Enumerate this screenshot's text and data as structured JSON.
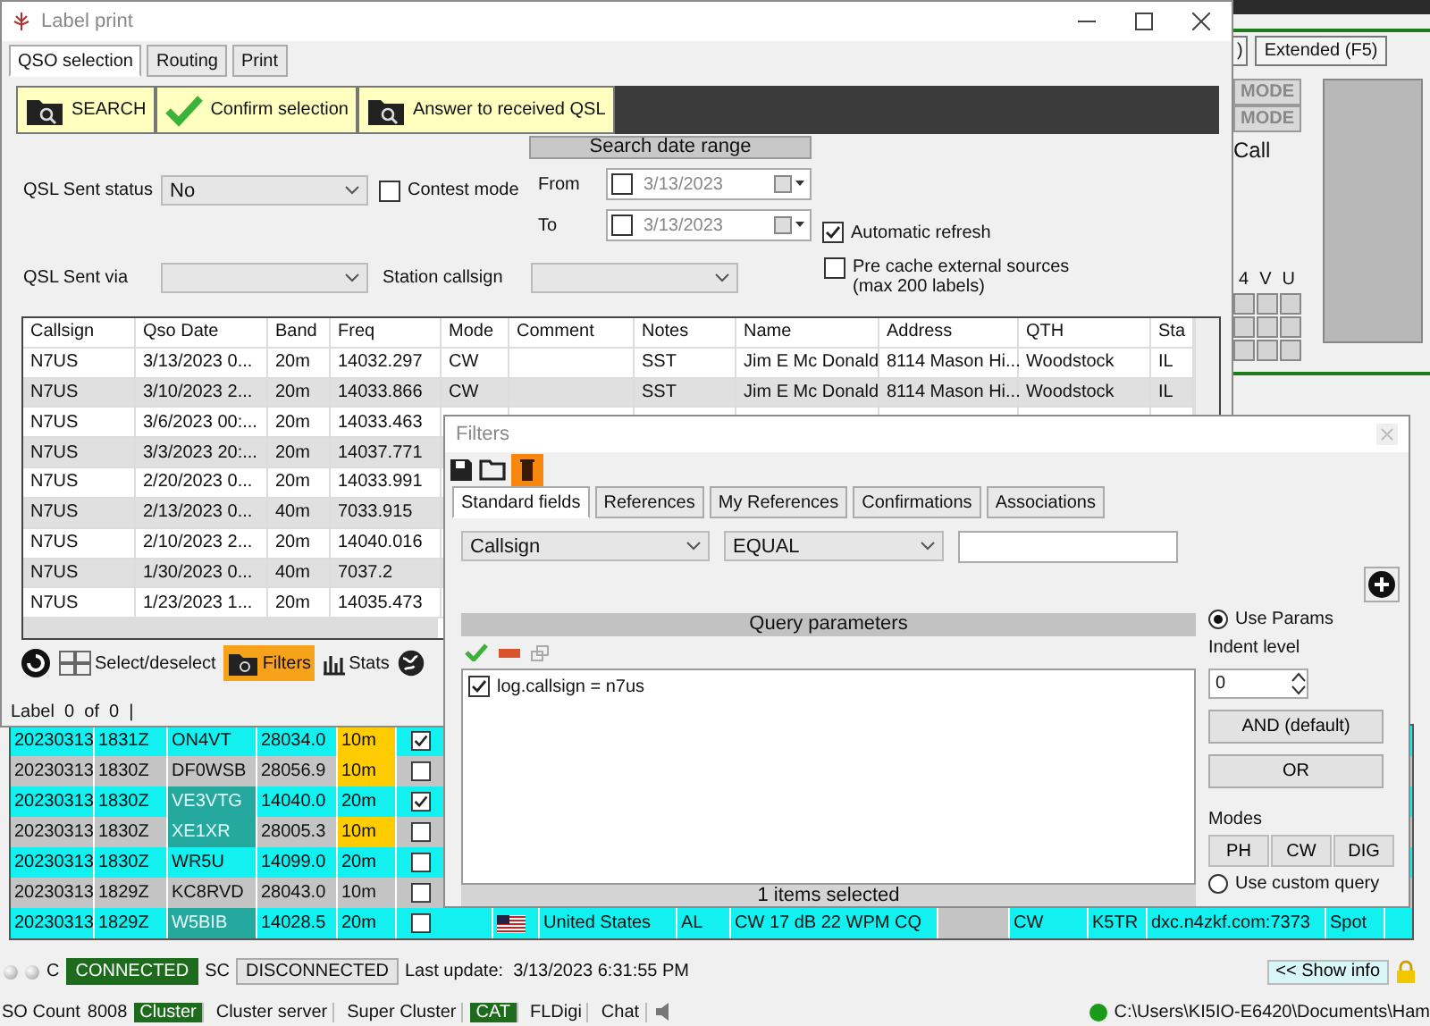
{
  "label_print": {
    "title": "Label print",
    "tabs": [
      {
        "label": "QSO selection",
        "selected": true
      },
      {
        "label": "Routing",
        "selected": false
      },
      {
        "label": "Print",
        "selected": false
      }
    ],
    "actions": [
      {
        "label": "SEARCH",
        "kind": "folder"
      },
      {
        "label": "Confirm selection",
        "kind": "check"
      },
      {
        "label": "Answer to received QSL",
        "kind": "folder"
      }
    ],
    "qsl_sent_status": {
      "label": "QSL Sent status",
      "value": "No"
    },
    "contest_mode": {
      "label": "Contest mode",
      "checked": false
    },
    "date_range": {
      "title": "Search date range",
      "fields": [
        {
          "label": "From",
          "value": "3/13/2023",
          "checked": false
        },
        {
          "label": "To",
          "value": "3/13/2023",
          "checked": false
        }
      ]
    },
    "automatic_refresh": {
      "label": "Automatic refresh",
      "checked": true
    },
    "qsl_sent_via": {
      "label": "QSL Sent via"
    },
    "station_callsign": {
      "label": "Station callsign"
    },
    "pre_cache": {
      "label": "Pre cache external sources\n(max 200 labels)",
      "checked": false
    },
    "table": {
      "columns": [
        "Callsign",
        "Qso Date",
        "Band",
        "Freq",
        "Mode",
        "Comment",
        "Notes",
        "Name",
        "Address",
        "QTH",
        "Sta"
      ],
      "rows": [
        {
          "callsign": "N7US",
          "qso_date": "3/13/2023 0...",
          "band": "20m",
          "freq": "14032.297",
          "mode": "CW",
          "notes": "SST",
          "name": "Jim E Mc Donald",
          "address": "8114 Mason Hi...",
          "qth": "Woodstock",
          "state": "IL"
        },
        {
          "callsign": "N7US",
          "qso_date": "3/10/2023 2...",
          "band": "20m",
          "freq": "14033.866",
          "mode": "CW",
          "notes": "SST",
          "name": "Jim E Mc Donald",
          "address": "8114 Mason Hi...",
          "qth": "Woodstock",
          "state": "IL"
        },
        {
          "callsign": "N7US",
          "qso_date": "3/6/2023 00:...",
          "band": "20m",
          "freq": "14033.463"
        },
        {
          "callsign": "N7US",
          "qso_date": "3/3/2023 20:...",
          "band": "20m",
          "freq": "14037.771"
        },
        {
          "callsign": "N7US",
          "qso_date": "2/20/2023 0...",
          "band": "20m",
          "freq": "14033.991"
        },
        {
          "callsign": "N7US",
          "qso_date": "2/13/2023 0...",
          "band": "40m",
          "freq": "7033.915"
        },
        {
          "callsign": "N7US",
          "qso_date": "2/10/2023 2...",
          "band": "20m",
          "freq": "14040.016"
        },
        {
          "callsign": "N7US",
          "qso_date": "1/30/2023 0...",
          "band": "40m",
          "freq": "7037.2"
        },
        {
          "callsign": "N7US",
          "qso_date": "1/23/2023 1...",
          "band": "20m",
          "freq": "14035.473"
        }
      ]
    },
    "tools": [
      {
        "kind": "refresh"
      },
      {
        "kind": "grid",
        "label": "Select/deselect",
        "selected": false
      },
      {
        "kind": "filter",
        "label": "Filters",
        "selected": true
      },
      {
        "kind": "stats",
        "label": "Stats",
        "selected": false
      },
      {
        "kind": "globe"
      }
    ],
    "counter": "Label  0  of  0  |"
  },
  "filters": {
    "title": "Filters",
    "tools": [
      {
        "kind": "save"
      },
      {
        "kind": "open"
      },
      {
        "kind": "delete"
      }
    ],
    "tabs": [
      {
        "label": "Standard fields",
        "selected": true
      },
      {
        "label": "References",
        "selected": false
      },
      {
        "label": "My References",
        "selected": false
      },
      {
        "label": "Confirmations",
        "selected": false
      },
      {
        "label": "Associations",
        "selected": false
      }
    ],
    "field": "Callsign",
    "operator": "EQUAL",
    "query": {
      "title": "Query parameters",
      "items": [
        {
          "text": "log.callsign = n7us",
          "checked": true
        }
      ],
      "footer": "1 items selected"
    },
    "use_params": {
      "label": "Use Params",
      "selected": true
    },
    "indent": {
      "label": "Indent level",
      "value": "0"
    },
    "logic_buttons": [
      "AND (default)",
      "OR"
    ],
    "modes": {
      "label": "Modes",
      "buttons": [
        "PH",
        "CW",
        "DIG"
      ]
    },
    "custom_query": {
      "label": "Use custom query",
      "selected": false
    }
  },
  "main": {
    "partial_button": ")",
    "extended_button": "Extended (F5)",
    "mode_buttons": [
      "MODE",
      "MODE"
    ],
    "call_label": "Call",
    "band_labels": [
      "4",
      "V",
      "U"
    ],
    "spots": [
      {
        "date": "20230313",
        "time": "1831Z",
        "call": "ON4VT",
        "freq": "28034.0",
        "band": "10m",
        "call_highlight": false,
        "band_highlight": true,
        "checked": true
      },
      {
        "date": "20230313",
        "time": "1830Z",
        "call": "DF0WSB",
        "freq": "28056.9",
        "band": "10m",
        "call_highlight": false,
        "band_highlight": true,
        "checked": false
      },
      {
        "date": "20230313",
        "time": "1830Z",
        "call": "VE3VTG",
        "freq": "14040.0",
        "band": "20m",
        "call_highlight": true,
        "band_highlight": false,
        "checked": true
      },
      {
        "date": "20230313",
        "time": "1830Z",
        "call": "XE1XR",
        "freq": "28005.3",
        "band": "10m",
        "call_highlight": true,
        "band_highlight": true,
        "checked": false
      },
      {
        "date": "20230313",
        "time": "1830Z",
        "call": "WR5U",
        "freq": "14099.0",
        "band": "20m",
        "call_highlight": false,
        "band_highlight": false,
        "checked": false
      },
      {
        "date": "20230313",
        "time": "1829Z",
        "call": "KC8RVD",
        "freq": "28043.0",
        "band": "10m",
        "call_highlight": false,
        "band_highlight": false,
        "checked": false
      },
      {
        "date": "20230313",
        "time": "1829Z",
        "call": "W5BIB",
        "freq": "14028.5",
        "band": "20m",
        "call_highlight": true,
        "band_highlight": false,
        "checked": false,
        "details": [
          {
            "kind": "flag"
          },
          {
            "kind": "text",
            "text": "United States"
          },
          {
            "kind": "text",
            "text": "AL"
          },
          {
            "kind": "text",
            "text": "CW 17 dB 22 WPM CQ"
          },
          {
            "kind": "empty"
          },
          {
            "kind": "text",
            "text": "CW"
          },
          {
            "kind": "text",
            "text": "K5TR"
          },
          {
            "kind": "text",
            "text": "dxc.n4zkf.com:7373"
          },
          {
            "kind": "text",
            "text": "Spot"
          }
        ]
      }
    ],
    "connections": [
      {
        "label": "C",
        "state": "CONNECTED",
        "connected": true
      },
      {
        "label": "SC",
        "state": "DISCONNECTED",
        "connected": false
      }
    ],
    "last_update": "Last update:  3/13/2023 6:31:55 PM",
    "show_info": "<< Show info",
    "count_label": "SO Count",
    "count": "8008",
    "services": [
      {
        "label": "Cluster",
        "on": true
      },
      {
        "label": "Cluster server",
        "on": false
      },
      {
        "label": "Super Cluster",
        "on": false
      },
      {
        "label": "CAT",
        "on": true
      },
      {
        "label": "FLDigi",
        "on": false
      },
      {
        "label": "Chat",
        "on": false
      }
    ],
    "path": "C:\\Users\\KI5IO-E6420\\Documents\\Ham"
  }
}
